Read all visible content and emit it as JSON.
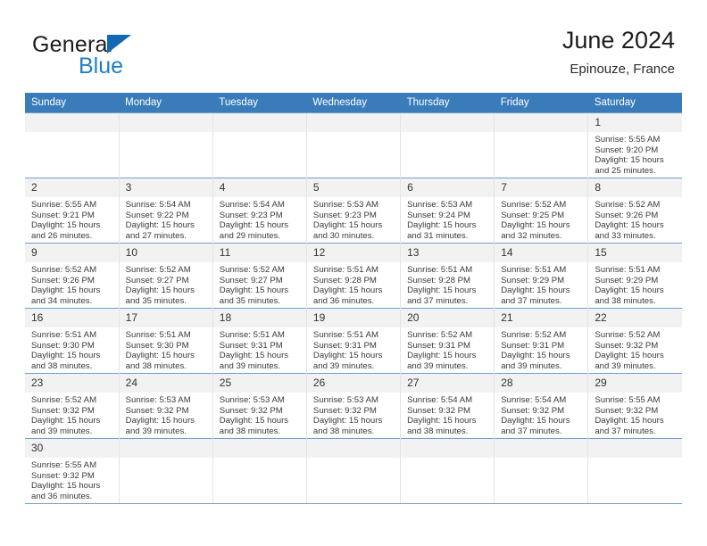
{
  "brand": {
    "name_top": "General",
    "name_bottom": "Blue",
    "triangle_color": "#1268b3",
    "blue_text_color": "#1e7ec8"
  },
  "header": {
    "title": "June 2024",
    "subtitle": "Epinouze, France"
  },
  "colors": {
    "header_band": "#3a7cba",
    "row_rule": "#6f9fd0",
    "daynum_band": "#f2f2f2",
    "column_rule": "#e4e4e4"
  },
  "weekdays": [
    "Sunday",
    "Monday",
    "Tuesday",
    "Wednesday",
    "Thursday",
    "Friday",
    "Saturday"
  ],
  "labels": {
    "sunrise_prefix": "Sunrise:",
    "sunset_prefix": "Sunset:",
    "daylight_prefix": "Daylight:"
  },
  "weeks": [
    [
      {
        "day": "",
        "empty": true
      },
      {
        "day": "",
        "empty": true
      },
      {
        "day": "",
        "empty": true
      },
      {
        "day": "",
        "empty": true
      },
      {
        "day": "",
        "empty": true
      },
      {
        "day": "",
        "empty": true
      },
      {
        "day": "1",
        "sunrise": "Sunrise: 5:55 AM",
        "sunset": "Sunset: 9:20 PM",
        "daylight_1": "Daylight: 15 hours",
        "daylight_2": "and 25 minutes."
      }
    ],
    [
      {
        "day": "2",
        "sunrise": "Sunrise: 5:55 AM",
        "sunset": "Sunset: 9:21 PM",
        "daylight_1": "Daylight: 15 hours",
        "daylight_2": "and 26 minutes."
      },
      {
        "day": "3",
        "sunrise": "Sunrise: 5:54 AM",
        "sunset": "Sunset: 9:22 PM",
        "daylight_1": "Daylight: 15 hours",
        "daylight_2": "and 27 minutes."
      },
      {
        "day": "4",
        "sunrise": "Sunrise: 5:54 AM",
        "sunset": "Sunset: 9:23 PM",
        "daylight_1": "Daylight: 15 hours",
        "daylight_2": "and 29 minutes."
      },
      {
        "day": "5",
        "sunrise": "Sunrise: 5:53 AM",
        "sunset": "Sunset: 9:23 PM",
        "daylight_1": "Daylight: 15 hours",
        "daylight_2": "and 30 minutes."
      },
      {
        "day": "6",
        "sunrise": "Sunrise: 5:53 AM",
        "sunset": "Sunset: 9:24 PM",
        "daylight_1": "Daylight: 15 hours",
        "daylight_2": "and 31 minutes."
      },
      {
        "day": "7",
        "sunrise": "Sunrise: 5:52 AM",
        "sunset": "Sunset: 9:25 PM",
        "daylight_1": "Daylight: 15 hours",
        "daylight_2": "and 32 minutes."
      },
      {
        "day": "8",
        "sunrise": "Sunrise: 5:52 AM",
        "sunset": "Sunset: 9:26 PM",
        "daylight_1": "Daylight: 15 hours",
        "daylight_2": "and 33 minutes."
      }
    ],
    [
      {
        "day": "9",
        "sunrise": "Sunrise: 5:52 AM",
        "sunset": "Sunset: 9:26 PM",
        "daylight_1": "Daylight: 15 hours",
        "daylight_2": "and 34 minutes."
      },
      {
        "day": "10",
        "sunrise": "Sunrise: 5:52 AM",
        "sunset": "Sunset: 9:27 PM",
        "daylight_1": "Daylight: 15 hours",
        "daylight_2": "and 35 minutes."
      },
      {
        "day": "11",
        "sunrise": "Sunrise: 5:52 AM",
        "sunset": "Sunset: 9:27 PM",
        "daylight_1": "Daylight: 15 hours",
        "daylight_2": "and 35 minutes."
      },
      {
        "day": "12",
        "sunrise": "Sunrise: 5:51 AM",
        "sunset": "Sunset: 9:28 PM",
        "daylight_1": "Daylight: 15 hours",
        "daylight_2": "and 36 minutes."
      },
      {
        "day": "13",
        "sunrise": "Sunrise: 5:51 AM",
        "sunset": "Sunset: 9:28 PM",
        "daylight_1": "Daylight: 15 hours",
        "daylight_2": "and 37 minutes."
      },
      {
        "day": "14",
        "sunrise": "Sunrise: 5:51 AM",
        "sunset": "Sunset: 9:29 PM",
        "daylight_1": "Daylight: 15 hours",
        "daylight_2": "and 37 minutes."
      },
      {
        "day": "15",
        "sunrise": "Sunrise: 5:51 AM",
        "sunset": "Sunset: 9:29 PM",
        "daylight_1": "Daylight: 15 hours",
        "daylight_2": "and 38 minutes."
      }
    ],
    [
      {
        "day": "16",
        "sunrise": "Sunrise: 5:51 AM",
        "sunset": "Sunset: 9:30 PM",
        "daylight_1": "Daylight: 15 hours",
        "daylight_2": "and 38 minutes."
      },
      {
        "day": "17",
        "sunrise": "Sunrise: 5:51 AM",
        "sunset": "Sunset: 9:30 PM",
        "daylight_1": "Daylight: 15 hours",
        "daylight_2": "and 38 minutes."
      },
      {
        "day": "18",
        "sunrise": "Sunrise: 5:51 AM",
        "sunset": "Sunset: 9:31 PM",
        "daylight_1": "Daylight: 15 hours",
        "daylight_2": "and 39 minutes."
      },
      {
        "day": "19",
        "sunrise": "Sunrise: 5:51 AM",
        "sunset": "Sunset: 9:31 PM",
        "daylight_1": "Daylight: 15 hours",
        "daylight_2": "and 39 minutes."
      },
      {
        "day": "20",
        "sunrise": "Sunrise: 5:52 AM",
        "sunset": "Sunset: 9:31 PM",
        "daylight_1": "Daylight: 15 hours",
        "daylight_2": "and 39 minutes."
      },
      {
        "day": "21",
        "sunrise": "Sunrise: 5:52 AM",
        "sunset": "Sunset: 9:31 PM",
        "daylight_1": "Daylight: 15 hours",
        "daylight_2": "and 39 minutes."
      },
      {
        "day": "22",
        "sunrise": "Sunrise: 5:52 AM",
        "sunset": "Sunset: 9:32 PM",
        "daylight_1": "Daylight: 15 hours",
        "daylight_2": "and 39 minutes."
      }
    ],
    [
      {
        "day": "23",
        "sunrise": "Sunrise: 5:52 AM",
        "sunset": "Sunset: 9:32 PM",
        "daylight_1": "Daylight: 15 hours",
        "daylight_2": "and 39 minutes."
      },
      {
        "day": "24",
        "sunrise": "Sunrise: 5:53 AM",
        "sunset": "Sunset: 9:32 PM",
        "daylight_1": "Daylight: 15 hours",
        "daylight_2": "and 39 minutes."
      },
      {
        "day": "25",
        "sunrise": "Sunrise: 5:53 AM",
        "sunset": "Sunset: 9:32 PM",
        "daylight_1": "Daylight: 15 hours",
        "daylight_2": "and 38 minutes."
      },
      {
        "day": "26",
        "sunrise": "Sunrise: 5:53 AM",
        "sunset": "Sunset: 9:32 PM",
        "daylight_1": "Daylight: 15 hours",
        "daylight_2": "and 38 minutes."
      },
      {
        "day": "27",
        "sunrise": "Sunrise: 5:54 AM",
        "sunset": "Sunset: 9:32 PM",
        "daylight_1": "Daylight: 15 hours",
        "daylight_2": "and 38 minutes."
      },
      {
        "day": "28",
        "sunrise": "Sunrise: 5:54 AM",
        "sunset": "Sunset: 9:32 PM",
        "daylight_1": "Daylight: 15 hours",
        "daylight_2": "and 37 minutes."
      },
      {
        "day": "29",
        "sunrise": "Sunrise: 5:55 AM",
        "sunset": "Sunset: 9:32 PM",
        "daylight_1": "Daylight: 15 hours",
        "daylight_2": "and 37 minutes."
      }
    ],
    [
      {
        "day": "30",
        "sunrise": "Sunrise: 5:55 AM",
        "sunset": "Sunset: 9:32 PM",
        "daylight_1": "Daylight: 15 hours",
        "daylight_2": "and 36 minutes."
      },
      {
        "day": "",
        "empty": true
      },
      {
        "day": "",
        "empty": true
      },
      {
        "day": "",
        "empty": true
      },
      {
        "day": "",
        "empty": true
      },
      {
        "day": "",
        "empty": true
      },
      {
        "day": "",
        "empty": true
      }
    ]
  ]
}
